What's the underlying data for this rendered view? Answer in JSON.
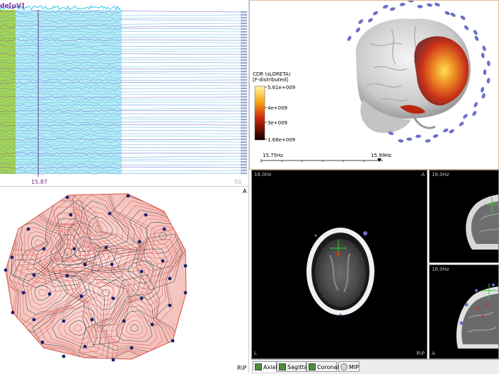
{
  "trace": {
    "title_fragment": "de[μV]",
    "cursor_time": "15.87",
    "right_value": "50",
    "colors": {
      "title": "#7a2d9c",
      "cursor_time": "#7a2d9c",
      "right_value": "#aaaaaa",
      "green_band": "#9acd32",
      "cyan_band": "#2ec4e6"
    }
  },
  "topomap": {
    "corner_top": "A",
    "corner_bottom": "R\\P",
    "colors": {
      "positive": "#d9534a",
      "electrode": "#1a1f6e"
    }
  },
  "brain3d": {
    "legend_title": "CDR (sLORETA)",
    "legend_subtitle": "[F-distributed]",
    "legend_ticks": [
      "5.61e+009",
      "4e+009",
      "3e+009",
      "1.68e+009"
    ],
    "range_start": "15.75Hz",
    "range_end": "15.99Hz",
    "colors": {
      "electrode": "#6b70c9",
      "activation": "#d23b1b"
    }
  },
  "mri": {
    "axial": {
      "freq": "16.0Hz",
      "corner_right": "A",
      "corner_bottom_left": "L",
      "corner_bottom_right": "R\\P"
    },
    "sagittal": {
      "freq": "16.0Hz"
    },
    "coronal": {
      "freq": "16.0Hz",
      "corner_bottom_left": "A"
    },
    "crosshair_color": "#2fd12f"
  },
  "tabs": [
    {
      "label": "Axial",
      "icon": "axial-view-icon",
      "active": true
    },
    {
      "label": "Sagittal",
      "icon": "sagittal-view-icon",
      "active": false
    },
    {
      "label": "Coronal",
      "icon": "coronal-view-icon",
      "active": false
    },
    {
      "label": "MIP",
      "icon": "mip-view-icon",
      "active": false
    }
  ]
}
